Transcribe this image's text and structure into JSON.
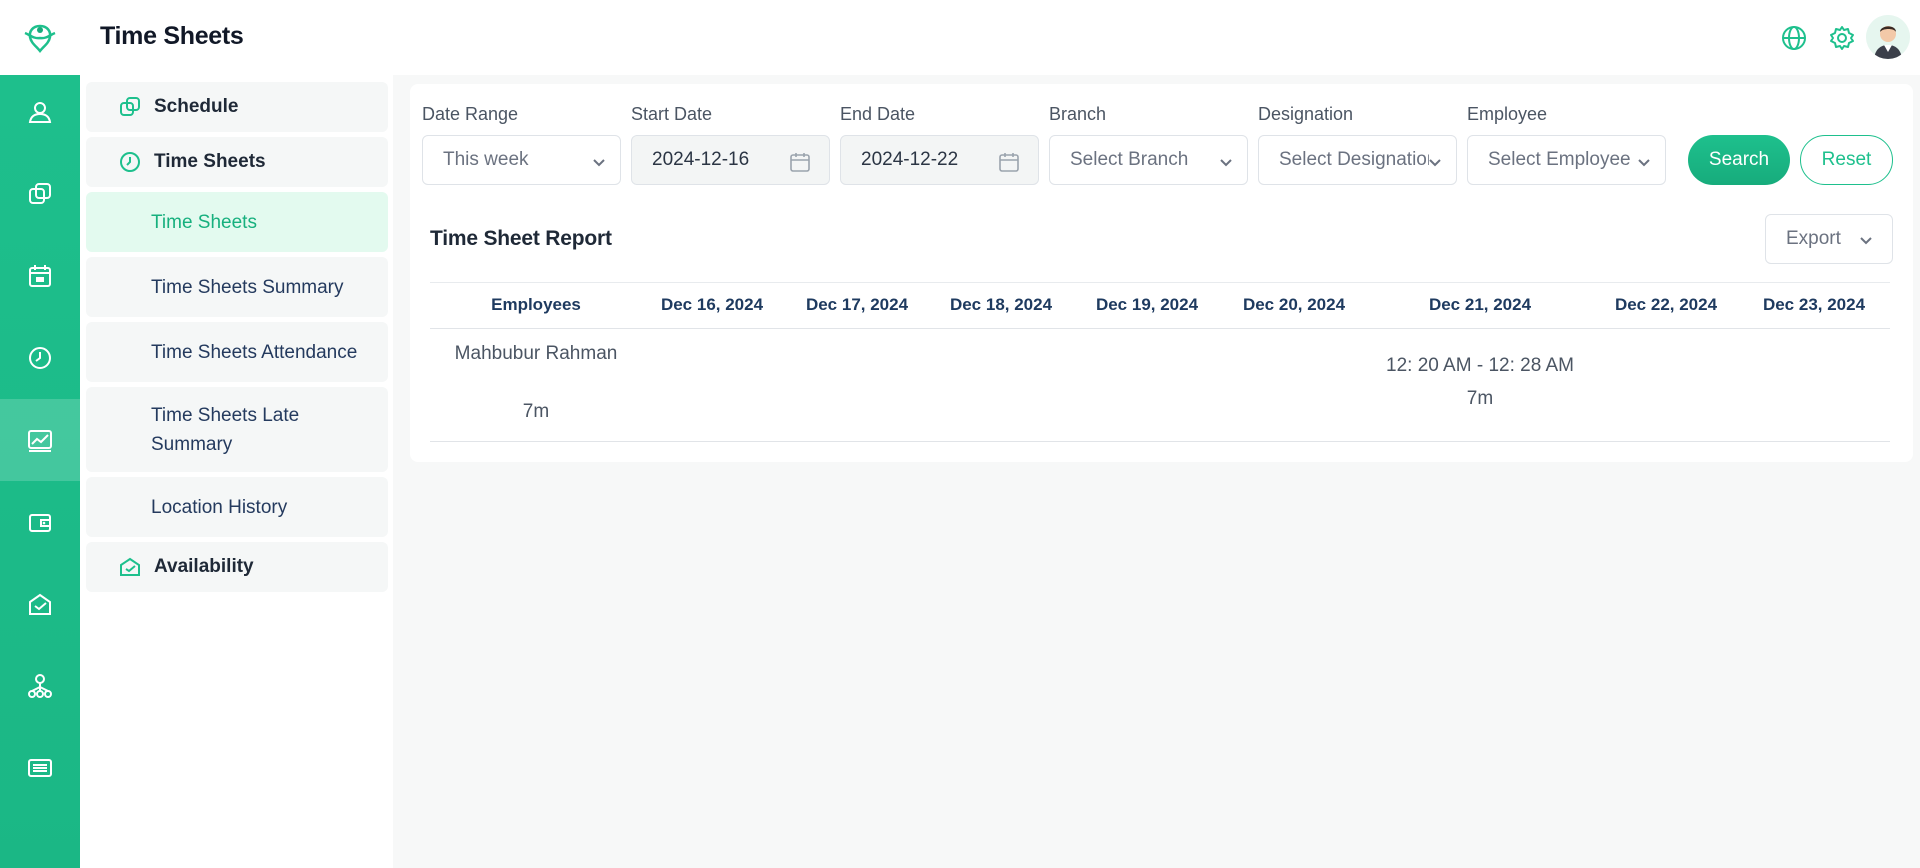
{
  "header": {
    "title": "Time Sheets"
  },
  "rail": {
    "items": [
      {
        "icon": "user-icon"
      },
      {
        "icon": "copy-icon"
      },
      {
        "icon": "calendar-icon"
      },
      {
        "icon": "clock-icon"
      },
      {
        "icon": "chart-icon",
        "active": true
      },
      {
        "icon": "wallet-icon"
      },
      {
        "icon": "check-envelope-icon"
      },
      {
        "icon": "hierarchy-icon"
      },
      {
        "icon": "list-icon"
      }
    ]
  },
  "subnav": {
    "schedule": "Schedule",
    "timesheets": "Time Sheets",
    "items": [
      {
        "label": "Time Sheets",
        "active": true
      },
      {
        "label": "Time Sheets Summary"
      },
      {
        "label": "Time Sheets Attendance"
      },
      {
        "label": "Time Sheets Late Summary"
      },
      {
        "label": "Location History"
      }
    ],
    "availability": "Availability"
  },
  "filters": {
    "date_range": {
      "label": "Date Range",
      "value": "This week"
    },
    "start_date": {
      "label": "Start Date",
      "value": "2024-12-16"
    },
    "end_date": {
      "label": "End Date",
      "value": "2024-12-22"
    },
    "branch": {
      "label": "Branch",
      "placeholder": "Select Branch"
    },
    "designation": {
      "label": "Designation",
      "placeholder": "Select Designation"
    },
    "employee": {
      "label": "Employee",
      "placeholder": "Select Employee"
    },
    "search_label": "Search",
    "reset_label": "Reset"
  },
  "report": {
    "title": "Time Sheet Report",
    "export_label": "Export",
    "columns": [
      "Employees",
      "Dec 16, 2024",
      "Dec 17, 2024",
      "Dec 18, 2024",
      "Dec 19, 2024",
      "Dec 20, 2024",
      "Dec 21, 2024",
      "Dec 22, 2024",
      "Dec 23, 2024"
    ],
    "rows": [
      {
        "employee": "Mahbubur Rahman",
        "total": "7m",
        "dec21_time": "12: 20 AM - 12: 28 AM",
        "dec21_duration": "7m"
      }
    ]
  },
  "colors": {
    "accent": "#1ec08d",
    "accent_dark": "#17ac7c",
    "heading": "#1e3a5f"
  }
}
